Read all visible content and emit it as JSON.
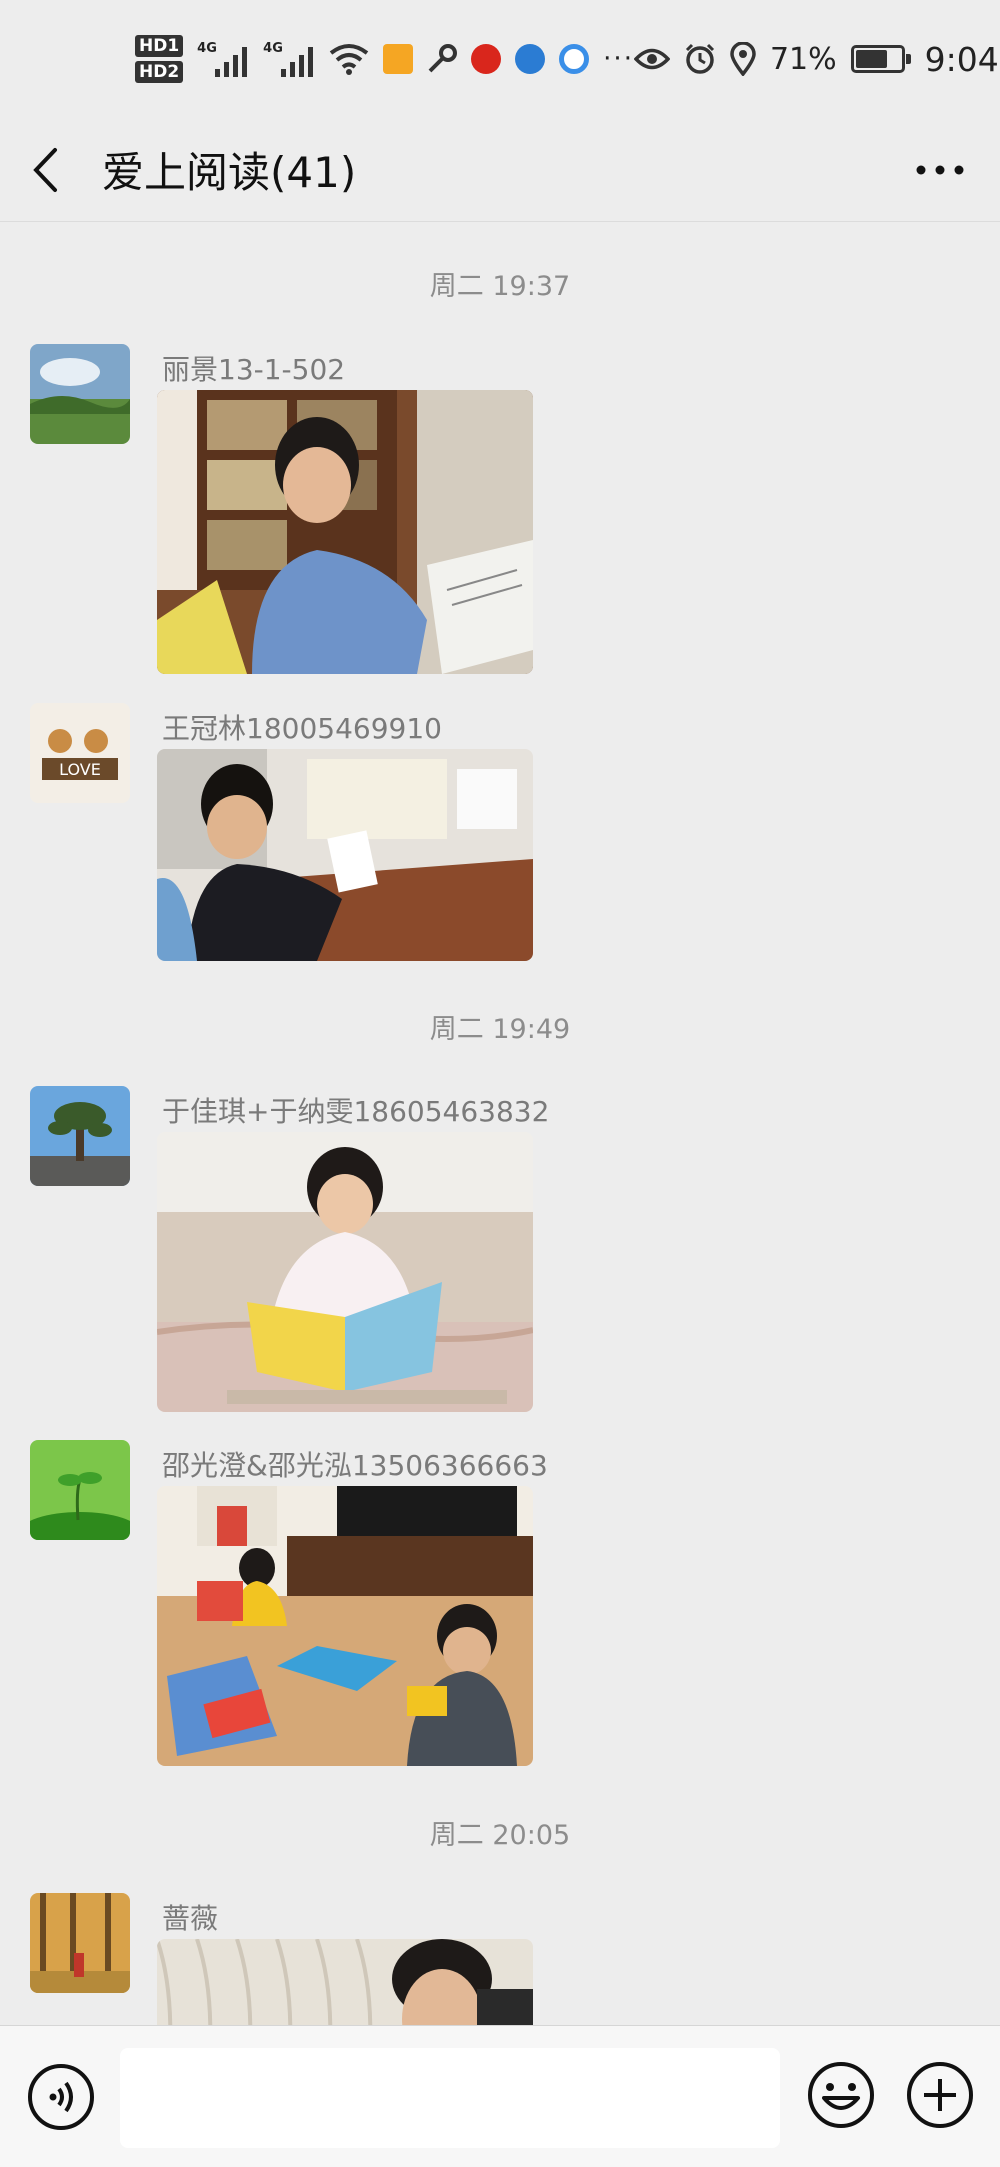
{
  "status_bar": {
    "hd1": "HD1",
    "hd2": "HD2",
    "sig1": "4G",
    "sig2": "4G",
    "app_icons": [
      "weather-app-icon",
      "key-icon",
      "red-app-icon",
      "blue-app-icon",
      "browser-app-icon"
    ],
    "more": "···",
    "battery": "71%",
    "battery_level": 0.71,
    "time": "9:04"
  },
  "header": {
    "title": "爱上阅读(41)"
  },
  "chat": {
    "timestamps": [
      "周二 19:37",
      "周二 19:49",
      "周二 20:05"
    ],
    "messages": [
      {
        "sender": "丽景13-1-502"
      },
      {
        "sender": "王冠林18005469910"
      },
      {
        "sender": "于佳琪+于纳雯18605463832"
      },
      {
        "sender": "邵光澄&邵光泓13506366663"
      },
      {
        "sender": "蔷薇"
      }
    ]
  },
  "input_bar": {
    "placeholder": ""
  },
  "colors": {
    "background": "#ededed",
    "timestamp": "#8c8c8c",
    "sender": "#7a7a7a"
  }
}
